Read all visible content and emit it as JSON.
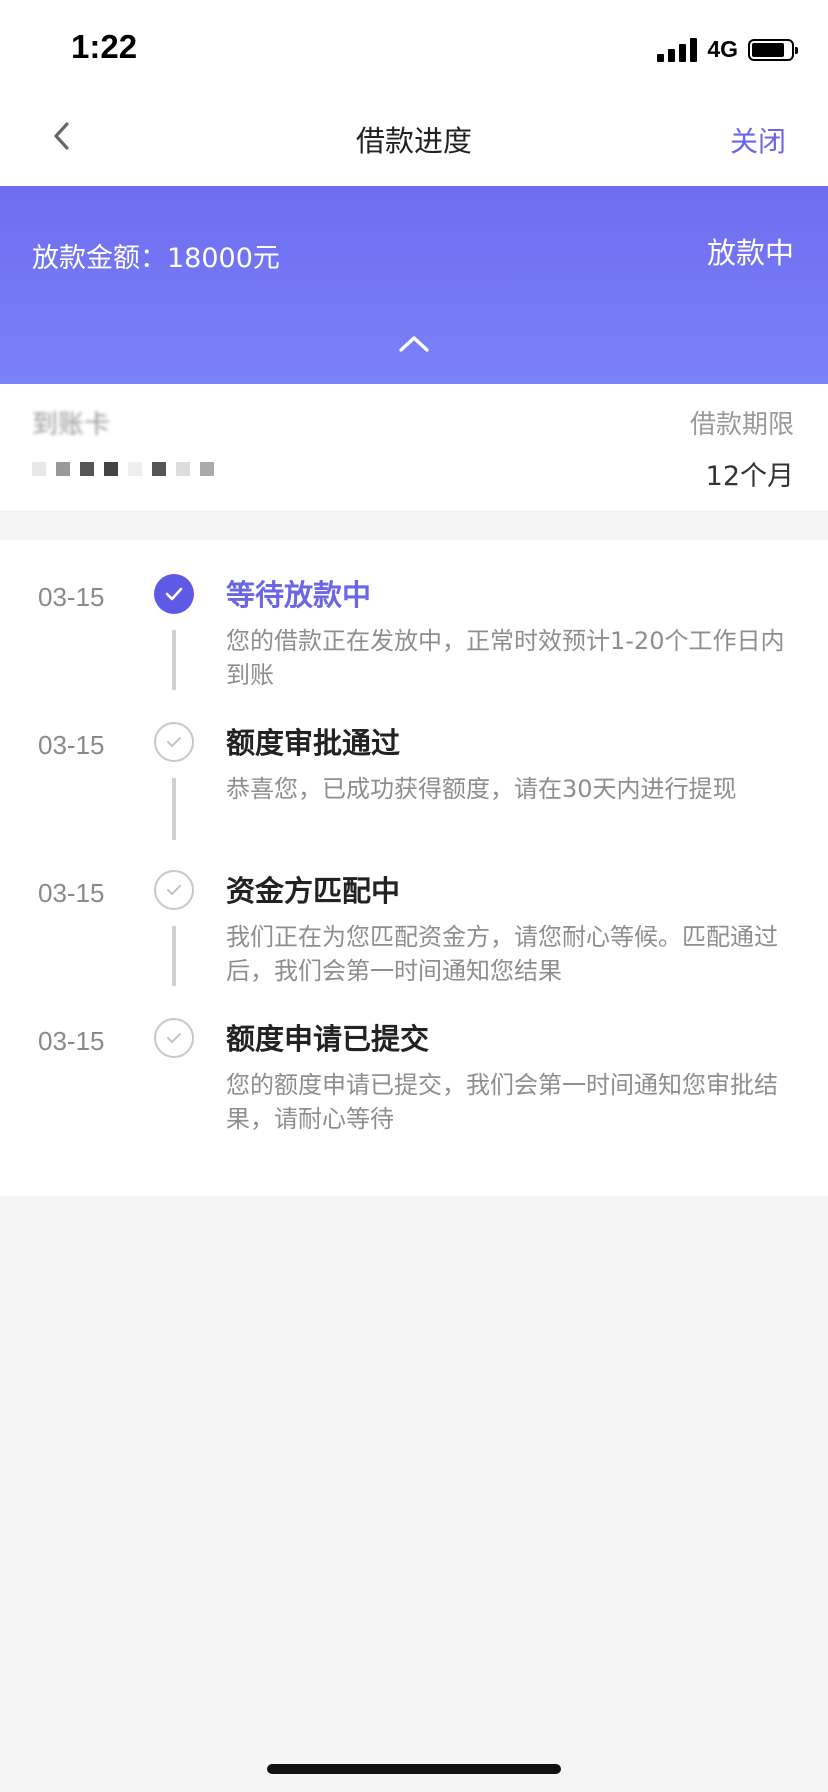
{
  "status_bar": {
    "time": "1:22",
    "network": "4G",
    "battery_fraction": 0.85
  },
  "nav": {
    "title": "借款进度",
    "close_label": "关闭",
    "back_icon": "chevron-left-icon"
  },
  "banner": {
    "amount_text": "放款金额：18000元",
    "status": "放款中",
    "toggle_icon": "chevron-up-icon",
    "gradient_top": "#6f6cf0",
    "gradient_bottom": "#7a82f8"
  },
  "info": {
    "card_label": "到账卡",
    "term_label": "借款期限",
    "term_value": "12个月"
  },
  "timeline": {
    "accent_color": "#5e5ae6",
    "steps": [
      {
        "date": "03-15",
        "title": "等待放款中",
        "desc": "您的借款正在发放中，正常时效预计1-20个工作日内到账",
        "state": "active"
      },
      {
        "date": "03-15",
        "title": "额度审批通过",
        "desc": "恭喜您，已成功获得额度，请在30天内进行提现",
        "state": "done"
      },
      {
        "date": "03-15",
        "title": "资金方匹配中",
        "desc": "我们正在为您匹配资金方，请您耐心等候。匹配通过后，我们会第一时间通知您结果",
        "state": "done"
      },
      {
        "date": "03-15",
        "title": "额度申请已提交",
        "desc": "您的额度申请已提交，我们会第一时间通知您审批结果，请耐心等待",
        "state": "done"
      }
    ]
  }
}
